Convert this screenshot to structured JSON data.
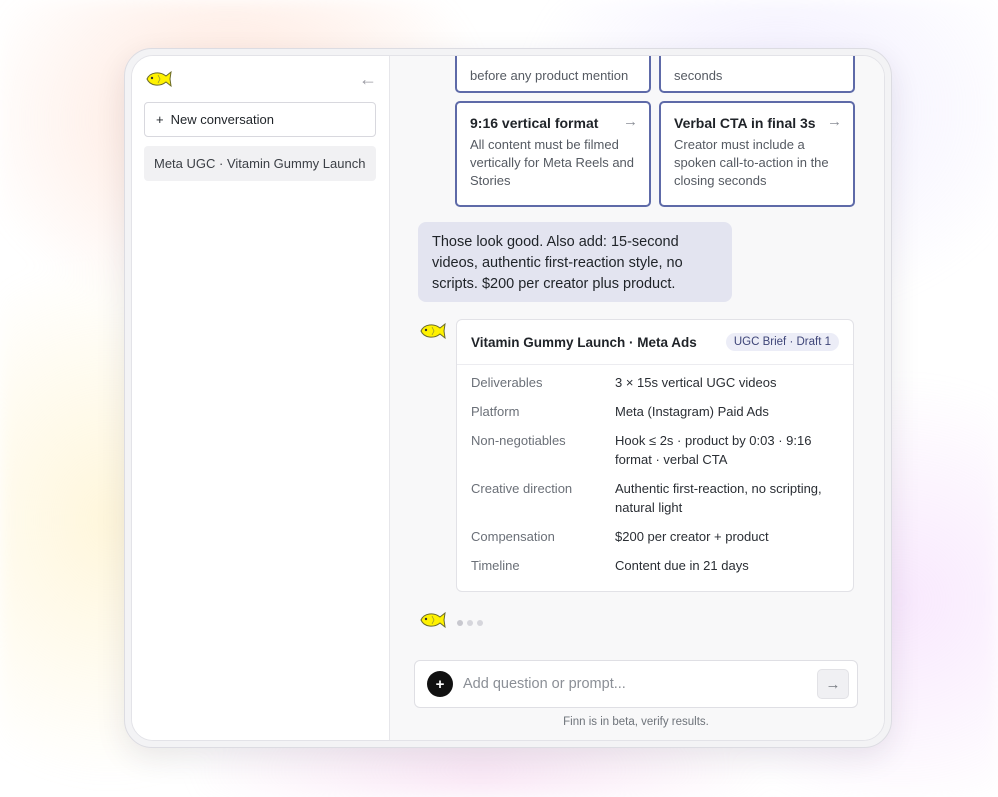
{
  "sidebar": {
    "logo_icon": "fish-icon",
    "collapse_icon": "arrow-left-icon",
    "collapse_glyph": "←",
    "new_conversation_plus": "+",
    "new_conversation_label": "New conversation",
    "conversations": [
      {
        "label": "Meta UGC · Vitamin Gummy Launch"
      }
    ]
  },
  "cards": [
    {
      "title": "",
      "desc": "before any product mention"
    },
    {
      "title": "",
      "desc": "seconds"
    },
    {
      "title": "9:16 vertical format",
      "desc": "All content must be filmed vertically for Meta Reels and Stories"
    },
    {
      "title": "Verbal CTA in final 3s",
      "desc": "Creator must include a spoken call-to-action in the closing seconds"
    }
  ],
  "card_arrow": "→",
  "user_message": "Those look good. Also add: 15-second videos, authentic first-reaction style, no scripts. $200 per creator plus product.",
  "brief": {
    "title": "Vitamin Gummy Launch · Meta Ads",
    "badge": "UGC Brief · Draft 1",
    "rows": [
      {
        "key": "Deliverables",
        "value": "3 × 15s vertical UGC videos"
      },
      {
        "key": "Platform",
        "value": "Meta (Instagram) Paid Ads"
      },
      {
        "key": "Non-negotiables",
        "value": "Hook ≤ 2s · product by 0:03 · 9:16 format · verbal CTA"
      },
      {
        "key": "Creative direction",
        "value": "Authentic first-reaction, no scripting, natural light"
      },
      {
        "key": "Compensation",
        "value": "$200 per creator + product"
      },
      {
        "key": "Timeline",
        "value": "Content due in 21 days"
      }
    ]
  },
  "composer": {
    "plus_glyph": "+",
    "placeholder": "Add question or prompt...",
    "send_glyph": "→"
  },
  "disclaimer": "Finn is in beta, verify results.",
  "colors": {
    "accent": "#5e6aa8",
    "fish": "#fff200",
    "user_bubble": "#e3e4f0"
  }
}
